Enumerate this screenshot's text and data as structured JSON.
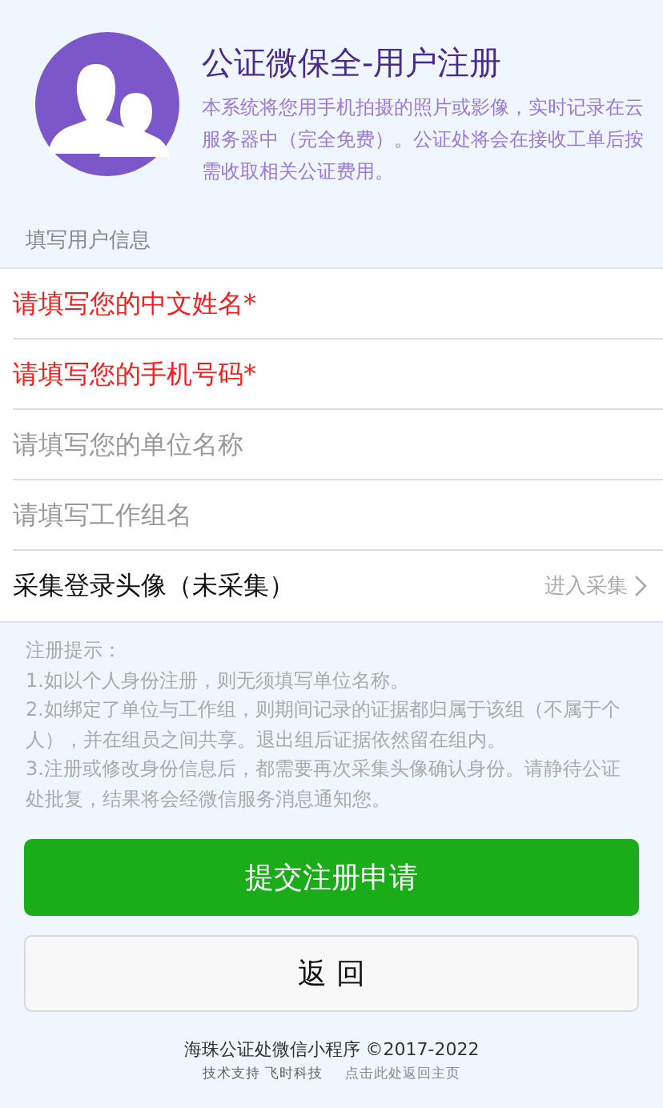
{
  "header": {
    "title": "公证微保全-用户注册",
    "description": "本系统将您用手机拍摄的照片或影像，实时记录在云服务器中（完全免费）。公证处将会在接收工单后按需收取相关公证费用。"
  },
  "section_label": "填写用户信息",
  "form_rows": [
    {
      "kind": "input",
      "placeholder": "请填写您的中文姓名*",
      "required": true
    },
    {
      "kind": "input",
      "placeholder": "请填写您的手机号码*",
      "required": true
    },
    {
      "kind": "input",
      "placeholder": "请填写您的单位名称",
      "required": false
    },
    {
      "kind": "input",
      "placeholder": "请填写工作组名",
      "required": false
    },
    {
      "kind": "link",
      "label": "采集登录头像（未采集）",
      "action": "进入采集"
    }
  ],
  "tips": [
    "注册提示：",
    "1.如以个人身份注册，则无须填写单位名称。",
    "2.如绑定了单位与工作组，则期间记录的证据都归属于该组（不属于个人），并在组员之间共享。退出组后证据依然留在组内。",
    "3.注册或修改身份信息后，都需要再次采集头像确认身份。请静待公证处批复，结果将会经微信服务消息通知您。"
  ],
  "buttons": [
    {
      "kind": "primary",
      "label": "提交注册申请"
    },
    {
      "kind": "default",
      "label": "返 回"
    }
  ],
  "footer": {
    "copyright": "海珠公证处微信小程序 ©2017-2022",
    "support": "技术支持 飞时科技",
    "home_link": "点击此处返回主页"
  }
}
